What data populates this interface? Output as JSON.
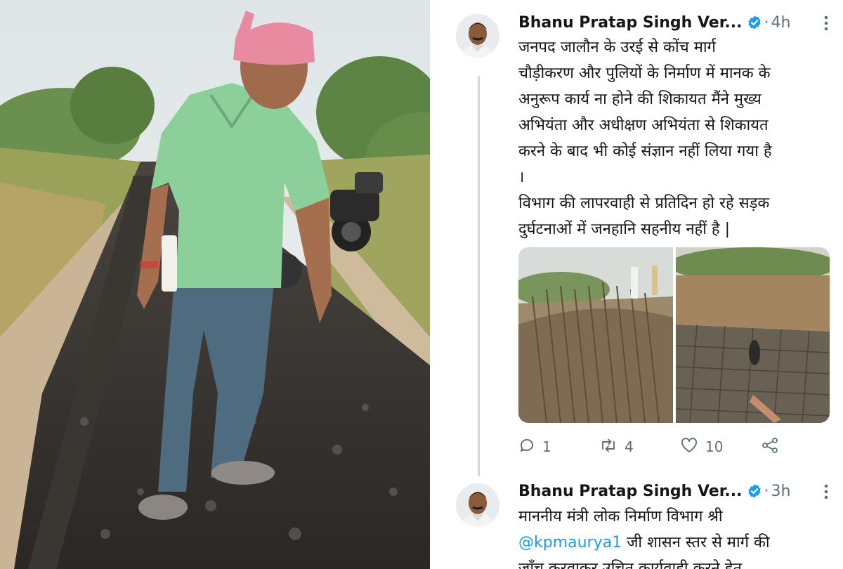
{
  "tweets": [
    {
      "author": "Bhanu Pratap Singh Ver...",
      "separator": "·",
      "time": "4h",
      "text_lines": [
        "जनपद जालौन के उरई से कोंच मार्ग",
        "चौड़ीकरण और पुलियों के निर्माण में मानक के",
        "अनुरूप कार्य ना होने की शिकायत मैंने मुख्य",
        "अभियंता और अधीक्षण अभियंता से शिकायत",
        "करने के बाद भी कोई संज्ञान नहीं लिया गया है",
        "।"
      ],
      "text_lines_2": [
        "विभाग की लापरवाही से प्रतिदिन हो रहे सड़क",
        "दुर्घटनाओं में जनहानि सहनीय नहीं है |"
      ],
      "stats": {
        "replies": "1",
        "retweets": "4",
        "likes": "10"
      }
    },
    {
      "author": "Bhanu Pratap Singh Ver...",
      "separator": "·",
      "time": "3h",
      "text_line_1": "माननीय मंत्री लोक निर्माण विभाग  श्री",
      "mention": "@kpmaurya1",
      "text_line_2_rest": " जी शासन स्तर से मार्ग की",
      "text_line_3": "जाँच करवाकर उचित कार्यवाही करने हेतु"
    }
  ],
  "icons": {
    "verified": "verified-badge-icon",
    "more": "more-vertical-icon",
    "reply": "reply-bubble-icon",
    "retweet": "retweet-icon",
    "like": "heart-icon",
    "share": "share-icon"
  },
  "colors": {
    "text_primary": "#14171a",
    "text_secondary": "#5b7083",
    "verified_blue": "#1d9bf0",
    "mention_blue": "#1d9bf0",
    "thread_line": "#cfd9de"
  }
}
